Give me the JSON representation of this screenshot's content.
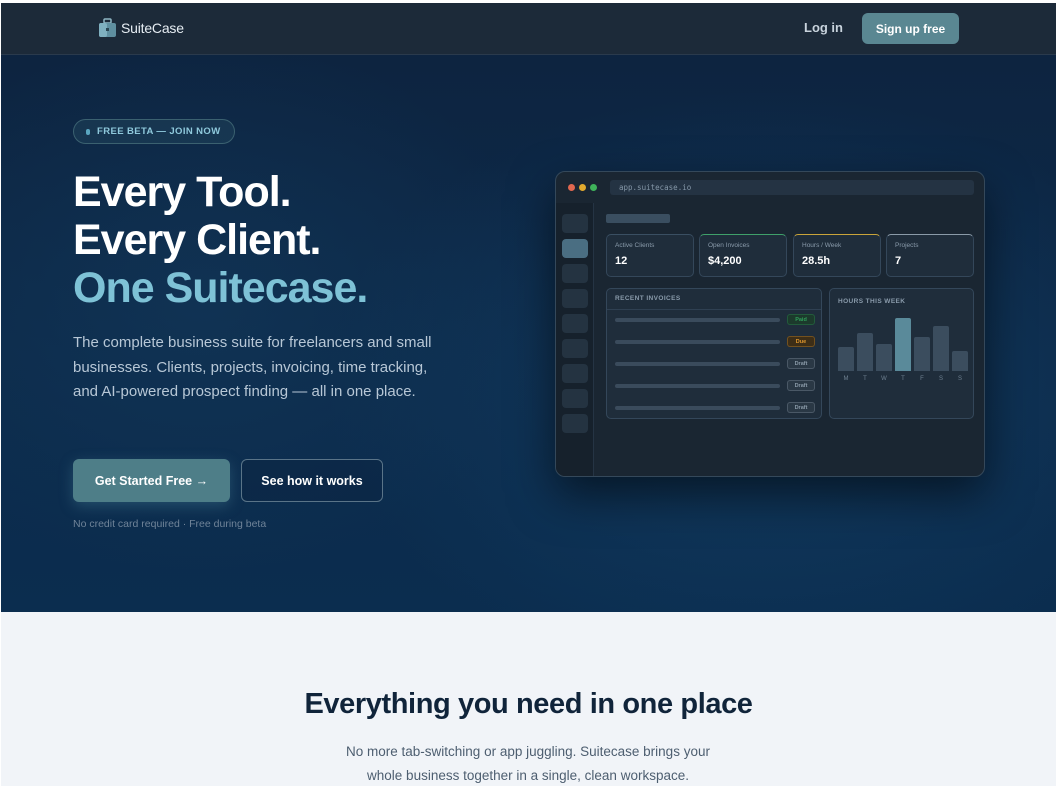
{
  "brand": {
    "name": "SuiteCase",
    "icon": "suitcase-icon"
  },
  "nav": {
    "login_label": "Log in",
    "signup_label": "Sign up free"
  },
  "hero": {
    "badge": "FREE BETA — JOIN NOW",
    "headline_line1": "Every Tool.",
    "headline_line2": "Every Client.",
    "headline_line3": "One Suitecase.",
    "lede": "The complete business suite for freelancers and small businesses. Clients, projects, invoicing, time tracking, and AI-powered prospect finding — all in one place.",
    "cta_primary": "Get Started Free →",
    "cta_secondary": "See how it works",
    "finenote": "No credit card required · Free during beta"
  },
  "preview": {
    "url": "app.suitecase.io",
    "stats": [
      {
        "label": "Active Clients",
        "value": "12",
        "accent": "#3a4f62"
      },
      {
        "label": "Open Invoices",
        "value": "$4,200",
        "accent": "#3fa06a"
      },
      {
        "label": "Hours / Week",
        "value": "28.5h",
        "accent": "#c9a43a"
      },
      {
        "label": "Projects",
        "value": "7",
        "accent": "#8a9aa8"
      }
    ],
    "invoices_title": "RECENT INVOICES",
    "invoices": [
      {
        "status": "Paid",
        "color": "#2f9e5a",
        "bg": "#1c3a2c"
      },
      {
        "status": "Due",
        "color": "#e0982e",
        "bg": "#3d2e17"
      },
      {
        "status": "Draft",
        "color": "#8a9aa8",
        "bg": "#2a3845"
      },
      {
        "status": "Draft",
        "color": "#8a9aa8",
        "bg": "#2a3845"
      },
      {
        "status": "Draft",
        "color": "#8a9aa8",
        "bg": "#2a3845"
      }
    ],
    "hours_title": "HOURS THIS WEEK",
    "hours": [
      {
        "day": "M",
        "level": 0.38,
        "highlight": false
      },
      {
        "day": "T",
        "level": 0.62,
        "highlight": false
      },
      {
        "day": "W",
        "level": 0.44,
        "highlight": false
      },
      {
        "day": "T",
        "level": 0.85,
        "highlight": true
      },
      {
        "day": "F",
        "level": 0.55,
        "highlight": false
      },
      {
        "day": "S",
        "level": 0.72,
        "highlight": false
      },
      {
        "day": "S",
        "level": 0.32,
        "highlight": false
      }
    ]
  },
  "features": {
    "title": "Everything you need in one place",
    "subtitle": "No more tab-switching or app juggling. Suitecase brings your whole business together in a single, clean workspace."
  }
}
